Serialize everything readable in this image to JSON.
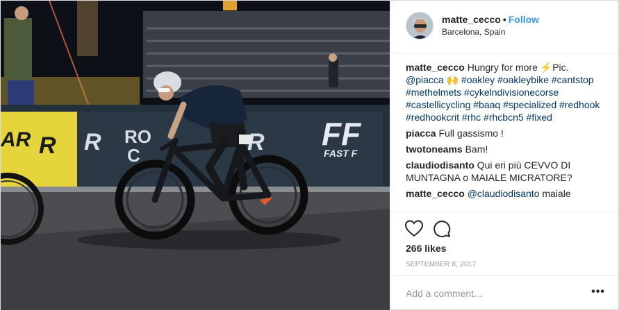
{
  "post": {
    "username": "matte_cecco",
    "separator": "•",
    "follow_label": "Follow",
    "location": "Barcelona, Spain",
    "banners": {
      "left_r": "R",
      "left_ar": "AR",
      "road": "RO",
      "road2": "C",
      "ffr": "FF",
      "ffr_sub": "FAST F"
    }
  },
  "caption": {
    "author": "matte_cecco",
    "text_before": " Hungry for more ",
    "bolt": "⚡",
    "text_after": "Pic. ",
    "mention": "@piacca",
    "hands": " 🙌",
    "hashtags": "#oakley #oakleybike #cantstop #methelmets #cykelndivisionecorse #castellicycling #baaq #specialized #redhook #redhookcrit #rhc #rhcbcn5 #fixed"
  },
  "comments": [
    {
      "author": "piacca",
      "text": " Full gassismo !"
    },
    {
      "author": "twotoneams",
      "text": " Bam!"
    },
    {
      "author": "claudiodisanto",
      "text": " Qui eri più CEVVO DI MUNTAGNA o MAIALE MICRATORE?"
    },
    {
      "author": "matte_cecco",
      "mention": " @claudiodisanto",
      "text": " maiale"
    }
  ],
  "stats": {
    "likes": "266 likes",
    "date": "SEPTEMBER 8, 2017"
  },
  "input": {
    "placeholder": "Add a comment...",
    "more_label": "•••"
  },
  "icons": {
    "like": "heart-icon",
    "comment": "speech-bubble-icon"
  },
  "colors": {
    "link": "#3897f0",
    "hashtag": "#003569",
    "muted": "#999999",
    "border": "#efefef"
  }
}
